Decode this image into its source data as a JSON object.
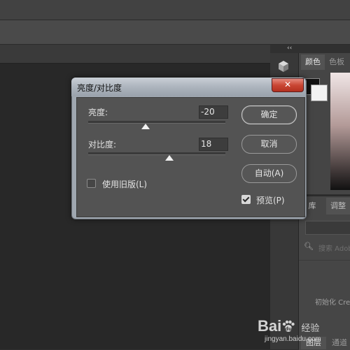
{
  "workspace": {
    "collapse_glyph": "‹‹",
    "tool_icon": "3d-cube-icon"
  },
  "color_panel": {
    "tabs": [
      "颜色",
      "色板"
    ],
    "foreground_color": "#111111",
    "background_color": "#f2f2f2"
  },
  "library_panel": {
    "tabs": [
      "库",
      "调整"
    ],
    "search_placeholder": "搜索 Adob",
    "init_text": "初始化 Cre"
  },
  "layers_panel": {
    "tabs": [
      "图层",
      "通道"
    ]
  },
  "dialog": {
    "title": "亮度/对比度",
    "close_glyph": "✕",
    "brightness": {
      "label": "亮度:",
      "value": "-20",
      "slider_fraction": 0.42
    },
    "contrast": {
      "label": "对比度:",
      "value": "18",
      "slider_fraction": 0.59
    },
    "use_legacy": {
      "label": "使用旧版(L)",
      "checked": false
    },
    "buttons": {
      "ok": "确定",
      "cancel": "取消",
      "auto": "自动(A)"
    },
    "preview": {
      "label": "预览(P)",
      "checked": true
    }
  },
  "watermark": {
    "logo": "Bai",
    "logo_suffix": "经验",
    "url": "jingyan.baidu.com"
  },
  "colors": {
    "close_button": "#c94634",
    "dialog_frame": "#9fa7b0",
    "dialog_body": "#535353"
  }
}
